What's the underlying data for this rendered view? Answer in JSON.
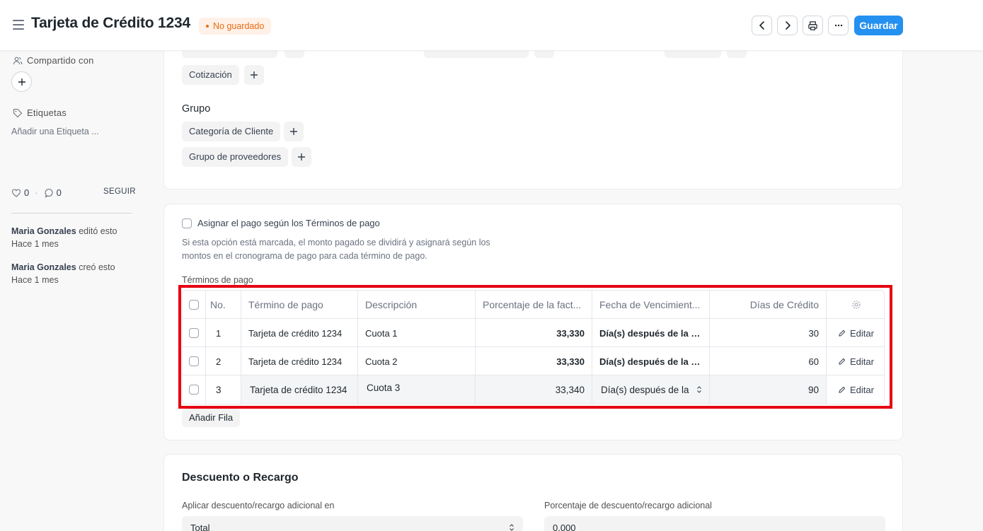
{
  "header": {
    "title": "Tarjeta de Crédito 1234",
    "status": "No guardado",
    "save_label": "Guardar"
  },
  "sidebar": {
    "shared_label": "Compartido con",
    "tags_label": "Etiquetas",
    "add_tag": "Añadir una Etiqueta ...",
    "likes": "0",
    "comments": "0",
    "follow": "SEGUIR",
    "activity": [
      {
        "user": "Maria Gonzales",
        "action": "editó esto",
        "time": "Hace 1 mes"
      },
      {
        "user": "Maria Gonzales",
        "action": "creó esto",
        "time": "Hace 1 mes"
      }
    ]
  },
  "card1": {
    "chip_cotizacion": "Cotización",
    "group_label": "Grupo",
    "chip_categoria": "Categoría de Cliente",
    "chip_proveedores": "Grupo de proveedores"
  },
  "payment": {
    "checkbox_label": "Asignar el pago según los Términos de pago",
    "description_line1": "Si esta opción está marcada, el monto pagado se dividirá y asignará según los",
    "description_line2": "montos en el cronograma de pago para cada término de pago.",
    "table_label": "Términos de pago",
    "add_row": "Añadir Fila",
    "columns": [
      "No.",
      "Término de pago",
      "Descripción",
      "Porcentaje de la fact...",
      "Fecha de Vencimient...",
      "Días de Crédito"
    ],
    "edit_label": "Editar",
    "rows": [
      {
        "no": "1",
        "term": "Tarjeta de crédito 1234",
        "desc": "Cuota 1",
        "pct": "33,330",
        "due": "Día(s) después de la fe...",
        "days": "30"
      },
      {
        "no": "2",
        "term": "Tarjeta de crédito 1234",
        "desc": "Cuota 2",
        "pct": "33,330",
        "due": "Día(s) después de la fe...",
        "days": "60"
      },
      {
        "no": "3",
        "term": "Tarjeta de crédito 1234",
        "desc": "Cuota 3",
        "pct": "33,340",
        "due": "Día(s) después de la",
        "days": "90"
      }
    ]
  },
  "discount": {
    "title": "Descuento o Recargo",
    "apply_label": "Aplicar descuento/recargo adicional en",
    "apply_value": "Total",
    "pct_label": "Porcentaje de descuento/recargo adicional",
    "pct_value": "0,000"
  },
  "colors": {
    "accent": "#2490ef",
    "highlight": "#e60012",
    "status": "#e86c13"
  }
}
